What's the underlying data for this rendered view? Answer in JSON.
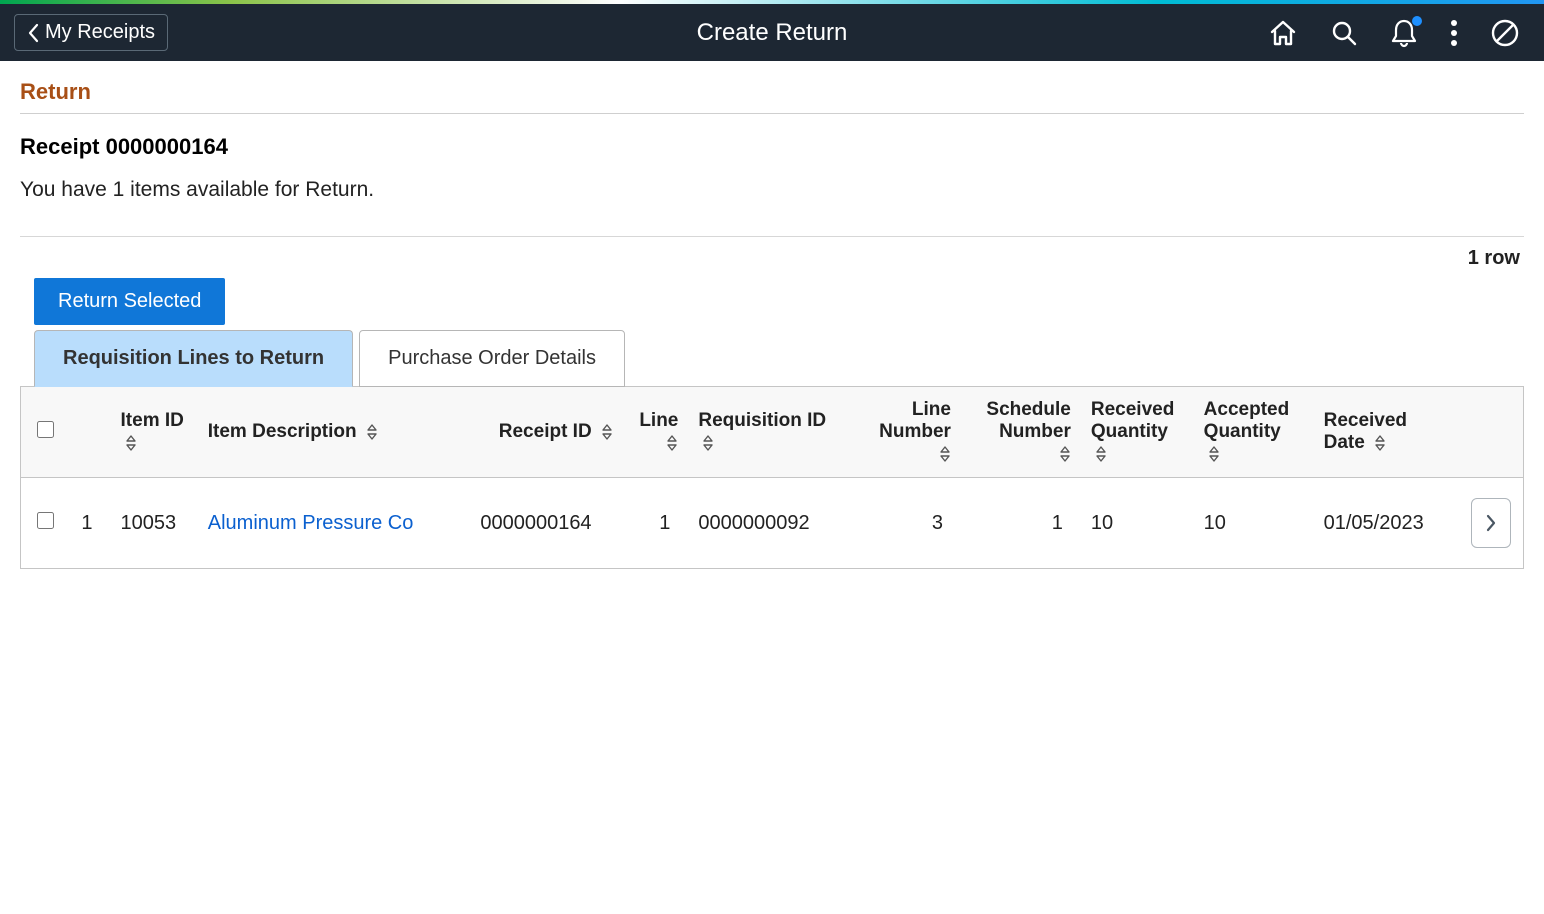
{
  "header": {
    "back_label": "My Receipts",
    "title": "Create Return"
  },
  "page": {
    "section_title": "Return",
    "receipt_heading": "Receipt 0000000164",
    "availability_text": "You have 1 items available for Return.",
    "row_count": "1 row",
    "return_button": "Return Selected"
  },
  "tabs": {
    "active": "Requisition Lines to Return",
    "other": "Purchase Order Details"
  },
  "columns": {
    "item_id": "Item ID",
    "description": "Item Description",
    "receipt_id": "Receipt ID",
    "line": "Line",
    "requisition_id": "Requisition ID",
    "line_number": "Line Number",
    "schedule_number": "Schedule Number",
    "received_qty": "Received Quantity",
    "accepted_qty": "Accepted Quantity",
    "received_date": "Received Date"
  },
  "rows": [
    {
      "idx": "1",
      "item_id": "10053",
      "description": "Aluminum Pressure Co",
      "receipt_id": "0000000164",
      "line": "1",
      "requisition_id": "0000000092",
      "line_number": "3",
      "schedule_number": "1",
      "received_qty": "10",
      "accepted_qty": "10",
      "received_date": "01/05/2023"
    }
  ]
}
